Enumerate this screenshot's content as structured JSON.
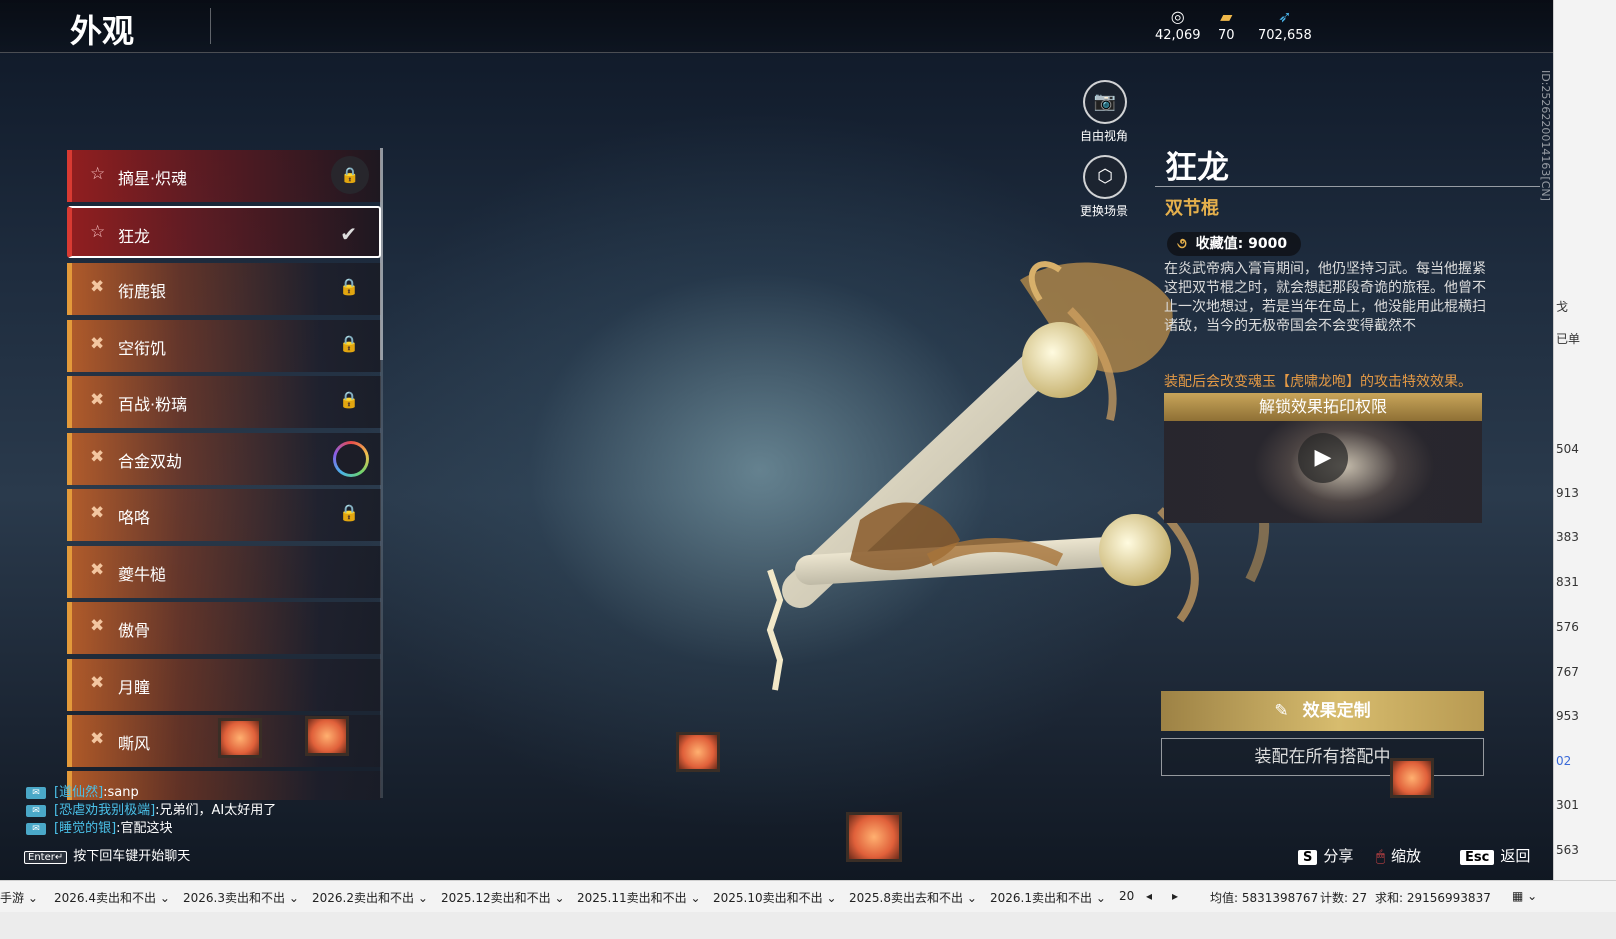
{
  "header": {
    "title": "外观",
    "currencies": [
      {
        "icon": "coin-icon",
        "value": "42,069"
      },
      {
        "icon": "ticket-icon",
        "value": "70"
      },
      {
        "icon": "feather-icon",
        "value": "702,658"
      }
    ]
  },
  "list": [
    {
      "label": "摘星·炽魂",
      "mark": "star",
      "color": "red",
      "state": "locked-badge"
    },
    {
      "label": "狂龙",
      "mark": "star",
      "color": "red",
      "state": "selected"
    },
    {
      "label": "衔鹿银",
      "mark": "cross",
      "color": "orange",
      "state": "locked"
    },
    {
      "label": "空衔饥",
      "mark": "cross",
      "color": "orange",
      "state": "locked"
    },
    {
      "label": "百战·粉璃",
      "mark": "cross",
      "color": "orange",
      "state": "locked"
    },
    {
      "label": "合金双劫",
      "mark": "cross",
      "color": "orange",
      "state": "ring"
    },
    {
      "label": "咯咯",
      "mark": "cross",
      "color": "orange",
      "state": "locked"
    },
    {
      "label": "夔牛槌",
      "mark": "cross",
      "color": "orange",
      "state": ""
    },
    {
      "label": "傲骨",
      "mark": "cross",
      "color": "orange",
      "state": ""
    },
    {
      "label": "月瞳",
      "mark": "cross",
      "color": "orange",
      "state": ""
    },
    {
      "label": "嘶风",
      "mark": "cross",
      "color": "orange",
      "state": ""
    }
  ],
  "camera": {
    "free_view": "自由视角",
    "change_scene": "更换场景"
  },
  "detail": {
    "name": "狂龙",
    "type": "双节棍",
    "collection_label": "收藏值:",
    "collection_value": "9000",
    "description": "在炎武帝病入膏肓期间，他仍坚持习武。每当他握紧这把双节棍之时，就会想起那段奇诡的旅程。他曾不止一次地想过，若是当年在岛上，他没能用此棍横扫诸敌，当今的无极帝国会不会变得截然不",
    "effect_note": "装配后会改变魂玉【虎啸龙咆】的攻击特效效果。",
    "unlock_title": "解锁效果拓印权限",
    "customize_button": "效果定制",
    "equip_button": "装配在所有搭配中"
  },
  "vertical_id": "ID:2526220014163[CN]",
  "chat": {
    "lines": [
      {
        "name": "[道仙然]",
        "text": ":sanp"
      },
      {
        "name": "[恐虐劝我别极端]",
        "text": ":兄弟们，AI太好用了"
      },
      {
        "name": "[睡觉的银]",
        "text": ":官配这块"
      }
    ],
    "enter_key": "Enter↵",
    "enter_hint": "按下回车键开始聊天"
  },
  "hints": [
    {
      "key": "S",
      "label": "分享"
    },
    {
      "key": "🖱",
      "label": "缩放"
    },
    {
      "key": "Esc",
      "label": "返回"
    }
  ],
  "sheet": {
    "tabs": [
      "手游",
      "2026.4卖出和不出",
      "2026.3卖出和不出",
      "2026.2卖出和不出",
      "2025.12卖出和不出",
      "2025.11卖出和不出",
      "2025.10卖出和不出",
      "2025.8卖出去和不出",
      "2026.1卖出和不出",
      "20"
    ],
    "avg": "均值: 5831398767",
    "count": "计数: 27",
    "sum": "求和: 29156993837",
    "edge_numbers": [
      "504",
      "913",
      "383",
      "831",
      "576",
      "767",
      "953",
      "02",
      "301",
      "563"
    ],
    "edge_text": [
      "戈",
      "已单"
    ]
  }
}
